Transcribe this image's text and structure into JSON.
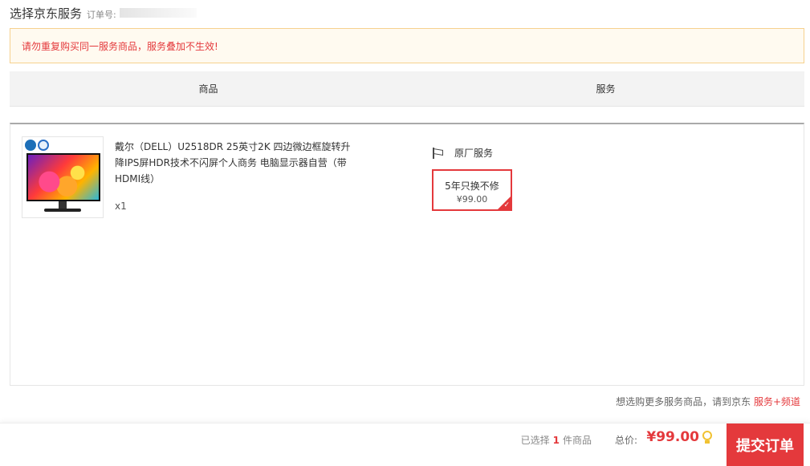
{
  "header": {
    "title": "选择京东服务",
    "order_label": "订单号: "
  },
  "notice": {
    "text": "请勿重复购买同一服务商品，服务叠加不生效!"
  },
  "table": {
    "col_product": "商品",
    "col_service": "服务"
  },
  "product": {
    "name": "戴尔（DELL）U2518DR 25英寸2K 四边微边框旋转升降IPS屏HDR技术不闪屏个人商务 电脑显示器自营（带HDMI线）",
    "quantity": "x1"
  },
  "service": {
    "type_label": "原厂服务",
    "option_name": "5年只换不修",
    "option_price": "¥99.00",
    "option_selected": true
  },
  "more_services": {
    "text": "想选购更多服务商品，请到京东 ",
    "link_label": "服务+频道"
  },
  "footer": {
    "selected_prefix": "已选择",
    "selected_count": "1",
    "selected_suffix": "件商品",
    "total_label": "总价:",
    "total_price": "¥99.00",
    "checkout_label": "提交订单"
  },
  "colors": {
    "accent": "#e4393c",
    "notice_bg": "#fffaf0",
    "notice_border": "#f6d18e"
  }
}
